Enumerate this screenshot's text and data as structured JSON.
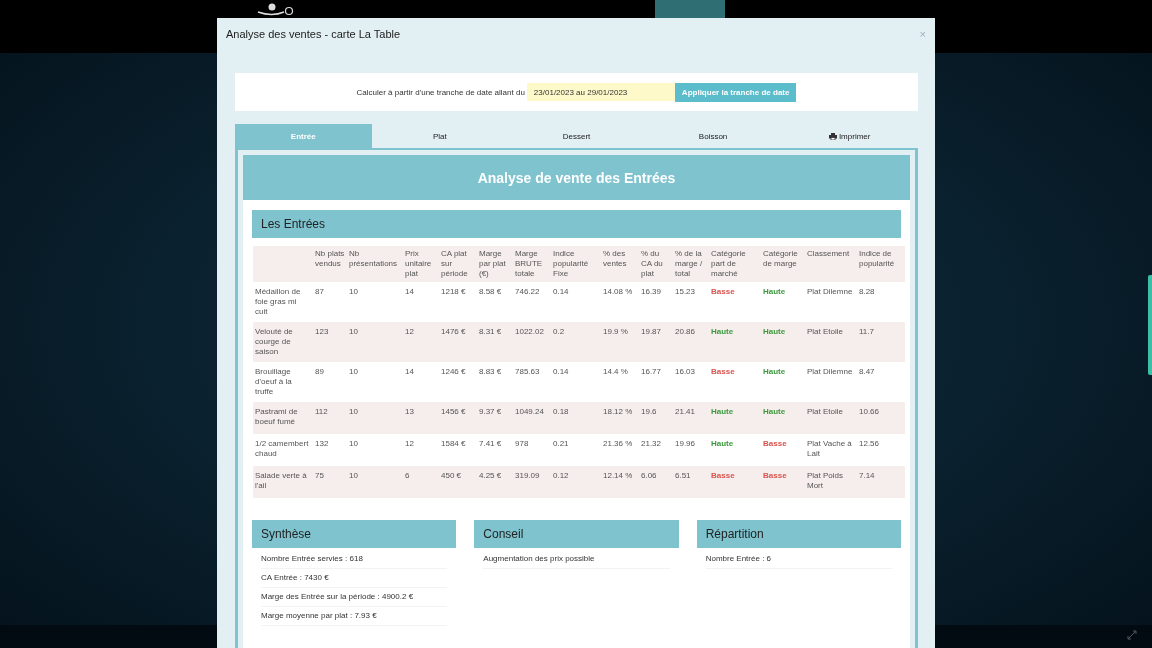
{
  "modal": {
    "title": "Analyse des ventes - carte La Table",
    "close": "×"
  },
  "date_bar": {
    "label": "Calculer à partir d'une tranche de date allant du",
    "value": "23/01/2023 au 29/01/2023",
    "button": "Appliquer la tranche de date"
  },
  "tabs": [
    {
      "label": "Entrée",
      "selected": true,
      "kind": "tab"
    },
    {
      "label": "Plat",
      "selected": false,
      "kind": "tab"
    },
    {
      "label": "Dessert",
      "selected": false,
      "kind": "tab"
    },
    {
      "label": "Boisson",
      "selected": false,
      "kind": "tab"
    },
    {
      "label": "Imprimer",
      "selected": false,
      "kind": "print"
    }
  ],
  "panel_title": "Analyse de vente des Entrées",
  "section_title": "Les Entrées",
  "table": {
    "columns": [
      "",
      "Nb plats vendus",
      "Nb présentations",
      "Prix unitaire plat",
      "CA plat sur période",
      "Marge par plat (€)",
      "Marge BRUTE totale",
      "Indice popularité Fixe",
      "% des ventes",
      "% du CA du plat",
      "% de la marge / total",
      "Catégorie part de marché",
      "Catégorie de marge",
      "Classement",
      "Indice de popularité"
    ],
    "rows": [
      {
        "name": "Médaillon de foie gras mi cuit",
        "values": [
          "87",
          "10",
          "14",
          "1218 €",
          "8.58 €",
          "746.22",
          "0.14",
          "14.08 %",
          "16.39",
          "15.23"
        ],
        "market": {
          "text": "Basse",
          "color": "#d9534f"
        },
        "margin": {
          "text": "Haute",
          "color": "#3c9a3c"
        },
        "ranking": "Plat Dilemne",
        "index": "8.28"
      },
      {
        "name": "Velouté de courge de saison",
        "values": [
          "123",
          "10",
          "12",
          "1476 €",
          "8.31 €",
          "1022.02",
          "0.2",
          "19.9 %",
          "19.87",
          "20.86"
        ],
        "market": {
          "text": "Haute",
          "color": "#3c9a3c"
        },
        "margin": {
          "text": "Haute",
          "color": "#3c9a3c"
        },
        "ranking": "Plat Etoile",
        "index": "11.7"
      },
      {
        "name": "Brouillage d'oeuf à la truffe",
        "values": [
          "89",
          "10",
          "14",
          "1246 €",
          "8.83 €",
          "785.63",
          "0.14",
          "14.4 %",
          "16.77",
          "16.03"
        ],
        "market": {
          "text": "Basse",
          "color": "#d9534f"
        },
        "margin": {
          "text": "Haute",
          "color": "#3c9a3c"
        },
        "ranking": "Plat Dilemne",
        "index": "8.47"
      },
      {
        "name": "Pastrami de boeuf fumé",
        "values": [
          "112",
          "10",
          "13",
          "1456 €",
          "9.37 €",
          "1049.24",
          "0.18",
          "18.12 %",
          "19.6",
          "21.41"
        ],
        "market": {
          "text": "Haute",
          "color": "#3c9a3c"
        },
        "margin": {
          "text": "Haute",
          "color": "#3c9a3c"
        },
        "ranking": "Plat Etoile",
        "index": "10.66"
      },
      {
        "name": "1/2 camembert chaud",
        "values": [
          "132",
          "10",
          "12",
          "1584 €",
          "7.41 €",
          "978",
          "0.21",
          "21.36 %",
          "21.32",
          "19.96"
        ],
        "market": {
          "text": "Haute",
          "color": "#3c9a3c"
        },
        "margin": {
          "text": "Basse",
          "color": "#d9534f"
        },
        "ranking": "Plat Vache à Lait",
        "index": "12.56"
      },
      {
        "name": "Salade verte à l'ail",
        "values": [
          "75",
          "10",
          "6",
          "450 €",
          "4.25 €",
          "319.09",
          "0.12",
          "12.14 %",
          "6.06",
          "6.51"
        ],
        "market": {
          "text": "Basse",
          "color": "#d9534f"
        },
        "margin": {
          "text": "Basse",
          "color": "#d9534f"
        },
        "ranking": "Plat Poids Mort",
        "index": "7.14"
      }
    ]
  },
  "cards": [
    {
      "title": "Synthèse",
      "lines": [
        "Nombre Entrée servies : 618",
        "CA Entrée : 7430 €",
        "Marge des Entrée sur la période : 4900.2 €",
        "Marge moyenne par plat : 7.93 €"
      ]
    },
    {
      "title": "Conseil",
      "lines": [
        "Augmentation des prix possible"
      ]
    },
    {
      "title": "Répartition",
      "lines": [
        "Nombre Entrée : 6"
      ]
    }
  ]
}
